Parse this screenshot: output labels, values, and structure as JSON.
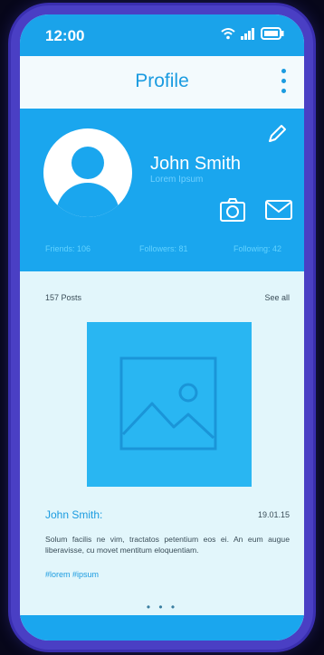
{
  "status_bar": {
    "time": "12:00"
  },
  "app_bar": {
    "title": "Profile"
  },
  "profile": {
    "name": "John Smith",
    "subtitle": "Lorem Ipsum",
    "stats": [
      {
        "label": "Friends: 106"
      },
      {
        "label": "Followers: 81"
      },
      {
        "label": "Following: 42"
      }
    ]
  },
  "posts": {
    "count_label": "157 Posts",
    "see_all_label": "See all"
  },
  "post": {
    "author": "John Smith:",
    "date": "19.01.15",
    "text": "Solum facilis ne vim, tractatos petentium eos ei. An eum augue liberavisse, cu movet mentitum eloquentiam.",
    "tags": "#lorem #ipsum"
  },
  "pagination": {
    "dots": "• • •"
  },
  "colors": {
    "primary": "#1aa6ee",
    "frame": "#4a3fc4",
    "background": "#d9f4fb"
  },
  "icons": [
    "wifi-icon",
    "signal-icon",
    "battery-icon",
    "more-vertical-icon",
    "edit-icon",
    "camera-icon",
    "mail-icon",
    "image-placeholder-icon"
  ]
}
